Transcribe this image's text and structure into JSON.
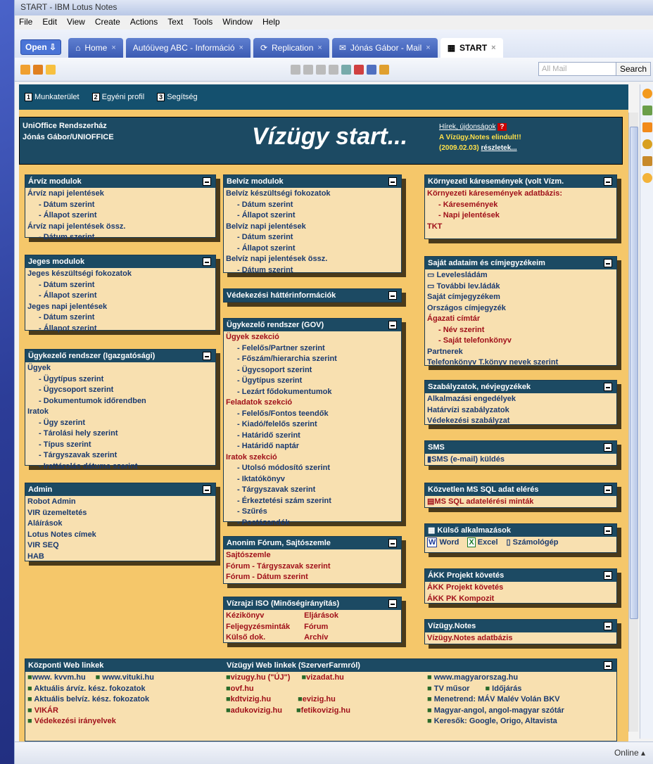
{
  "window": {
    "title": "START - IBM Lotus Notes"
  },
  "menu": [
    "File",
    "Edit",
    "View",
    "Create",
    "Actions",
    "Text",
    "Tools",
    "Window",
    "Help"
  ],
  "open_label": "Open",
  "tabs": [
    {
      "label": "Home",
      "active": false
    },
    {
      "label": "Autóüveg ABC - Információ",
      "active": false
    },
    {
      "label": "Replication",
      "active": false
    },
    {
      "label": "Jónás Gábor - Mail",
      "active": false
    },
    {
      "label": "START",
      "active": true
    }
  ],
  "toolbar": {
    "search_placeholder": "All Mail",
    "search_label": "Search"
  },
  "nav": {
    "item1": "Munkaterület",
    "item2": "Egyéni profil",
    "item3": "Segítség"
  },
  "header": {
    "org": "UniOffice Rendszerház",
    "user": "Jónás Gábor/UNIOFFICE",
    "title": "Vízügy start...",
    "news_link": "Hírek, újdonságok",
    "news_text": "A Vízügy.Notes elindult!!",
    "news_date": "(2009.02.03)",
    "news_more": "részletek..."
  },
  "boxes": {
    "arviz": {
      "title": "Árvíz modulok",
      "items": [
        "Árvíz napi jelentések",
        "- Dátum szerint",
        "- Állapot szerint",
        "Árvíz napi jelentések össz.",
        "- Dátum szerint"
      ]
    },
    "jeges": {
      "title": "Jeges modulok",
      "items": [
        "Jeges készültségi fokozatok",
        "- Dátum szerint",
        "- Állapot szerint",
        "Jeges napi jelentések",
        "- Dátum szerint",
        "- Állapot szerint"
      ]
    },
    "ugyig": {
      "title": "Ügykezelő rendszer (Igazgatósági)",
      "items": [
        "Ügyek",
        "- Ügytípus szerint",
        "- Ügycsoport szerint",
        "- Dokumentumok időrendben",
        "Iratok",
        "- Ügy szerint",
        "- Tárolási hely szerint",
        "- Típus szerint",
        "- Tárgyszavak szerint",
        "- Irattárolás dátuma szerint"
      ]
    },
    "admin": {
      "title": "Admin",
      "items": [
        "Robot Admin",
        "VIR üzemeltetés",
        "Aláírások",
        "Lotus Notes címek",
        "VIR SEQ",
        "HAB"
      ]
    },
    "belviz": {
      "title": "Belvíz modulok",
      "items": [
        "Belvíz készültségi fokozatok",
        "- Dátum szerint",
        "- Állapot szerint",
        "Belvíz napi jelentések",
        "- Dátum szerint",
        "- Állapot szerint",
        "Belvíz napi jelentések össz.",
        "- Dátum szerint"
      ]
    },
    "vedekezesi": {
      "title": "Védekezési háttérinformációk"
    },
    "gov": {
      "title": "Ügykezelő rendszer (GOV)",
      "items": [
        "Ügyek szekció",
        "- Felelős/Partner szerint",
        "- Főszám/hierarchia szerint",
        "- Ügycsoport szerint",
        "- Ügytípus szerint",
        "- Lezárt fődokumentumok",
        "Feladatok szekció",
        "- Felelős/Fontos teendők",
        "- Kiadó/felelős szerint",
        "- Határidő szerint",
        "- Határidő naptár",
        "Iratok szekció",
        "- Utolsó módosító szerint",
        "- Iktatókönyv",
        "- Tárgyszavak szerint",
        "- Érkeztetési szám szerint",
        "- Szűrés",
        "- Postázandók"
      ]
    },
    "forum": {
      "title": "Anonim Fórum, Sajtószemle",
      "items": [
        "Sajtószemle",
        "Fórum - Tárgyszavak szerint",
        "Fórum - Dátum szerint"
      ]
    },
    "iso": {
      "title": "Vízrajzi ISO (Minőségirányítás)",
      "left": [
        "Kézikönyv",
        "Feljegyzésminták",
        "Külső dok."
      ],
      "right": [
        "Eljárások",
        "Fórum",
        "Archív"
      ]
    },
    "kornyezeti": {
      "title": "Környezeti káresemények (volt Vízm.",
      "items": [
        "Környezeti káresemények adatbázis:",
        "- Káresemények",
        "- Napi jelentések",
        "TKT"
      ]
    },
    "sajat": {
      "title": "Saját adataim és címjegyzékeim",
      "items": [
        "Levelesládám",
        "További lev.ládák",
        "Saját címjegyzékem",
        "Országos címjegyzék",
        "Ágazati címtár",
        "- Név szerint",
        "- Saját telefonkönyv",
        "Partnerek",
        "Telefonkönyv T.könyv nevek szerint"
      ]
    },
    "szabalyzatok": {
      "title": "Szabályzatok, névjegyzékek",
      "items": [
        "Alkalmazási engedélyek",
        "Határvízi szabályzatok",
        "Védekezési szabályzat"
      ]
    },
    "sms": {
      "title": "SMS",
      "items": [
        "SMS (e-mail) küldés"
      ]
    },
    "mssql": {
      "title": "Közvetlen MS SQL adat elérés",
      "items": [
        "MS SQL adatelérési minták"
      ]
    },
    "kulso": {
      "title": "Külső alkalmazások",
      "items": [
        "Word",
        "Excel",
        "Számológép"
      ]
    },
    "akk": {
      "title": "ÁKK Projekt követés",
      "items": [
        "ÁKK Projekt követés",
        "ÁKK PK Kompozit"
      ]
    },
    "vizugynotes": {
      "title": "Vízügy.Notes",
      "items": [
        "Vízügy.Notes adatbázis"
      ]
    },
    "webcentral": {
      "title": "Központi Web linkek",
      "items": [
        "www. kvvm.hu",
        "www.vituki.hu",
        "Aktuális árvíz. kész. fokozatok",
        "Aktuális belvíz. kész. fokozatok",
        "VIKÁR",
        "Védekezési irányelvek"
      ]
    },
    "webvizugy": {
      "title": "Vízügyi Web linkek (SzerverFarmról)",
      "items": [
        "vizugy.hu (\"ÚJ\")",
        "vizadat.hu",
        "ovf.hu",
        "kdtvizig.hu",
        "evizig.hu",
        "adukovizig.hu",
        "fetikovizig.hu"
      ]
    },
    "webother": {
      "items": [
        "www.magyarorszag.hu",
        "TV műsor",
        "Időjárás",
        "Menetrend: MÁV Malév Volán BKV",
        "Magyar-angol, angol-magyar szótár",
        "Keresők: Google, Origo, Altavista"
      ]
    }
  },
  "status": {
    "online": "Online"
  }
}
